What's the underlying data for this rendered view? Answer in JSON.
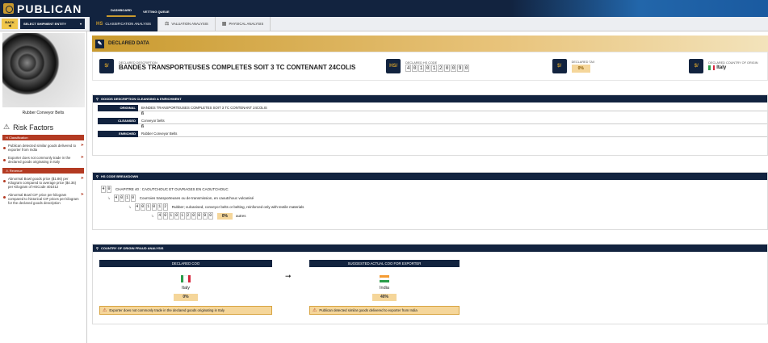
{
  "app": {
    "name": "PUBLICAN"
  },
  "topnav": [
    {
      "label": "DASHBOARD"
    },
    {
      "label": "VETTING QUEUE"
    }
  ],
  "secbar": {
    "back_label": "BACK",
    "shipment_select": "SELECT SHIPMENT ENTITY",
    "tabs": [
      {
        "label": "CLASSIFICATION ANALYSIS",
        "icon": "hs-icon",
        "active": true
      },
      {
        "label": "VALUATION ANALYSIS",
        "icon": "scale-icon",
        "active": false
      },
      {
        "label": "PHYSICAL ANALYSIS",
        "icon": "box-icon",
        "active": false
      }
    ]
  },
  "sidebar": {
    "product_name": "Rubber Conveyor Belts",
    "risk_title": "Risk Factors",
    "sections": [
      {
        "title": "Classification",
        "items": [
          "Publican detected similar goods delivered to exporter from India",
          "Exporter does not commonly trade in the declared goods originating in Italy"
        ]
      },
      {
        "title": "Revenue",
        "items": [
          "Abnormal Bowl goods price ($1.86) per Kilogram compared to average price ($4.35) per Kilogram of HSCode 401012",
          "Abnormal Bowl CIF price per kilogram compared to historical CIF prices per kilogram for the declared goods description"
        ]
      }
    ]
  },
  "declared": {
    "header": "DECLARED DATA",
    "description_label": "DECLARED DESCRIPTION",
    "description": "BANDES TRANSPORTEUSES COMPLETES SOIT 3 TC CONTENANT 24COLIS",
    "hs_label": "DECLARED HS CODE",
    "hs_code": [
      "4",
      "0",
      "1",
      "0",
      "1",
      "2",
      "0",
      "0",
      "9",
      "0"
    ],
    "tax_label": "DECLARED TAX",
    "tax": "0%",
    "country_label": "DECLARED COUNTRY OF ORIGIN",
    "country": "Italy"
  },
  "goods": {
    "header": "GOODS DESCRIPTION CLEANSING & ENRICHMENT",
    "rows": [
      {
        "label": "ORIGINAL",
        "value": "BANDES TRANSPORTEUSES COMPLETES SOIT 3 TC CONTENANT 24COLIS"
      },
      {
        "label": "CLEANSED",
        "value": "Conveyor belts"
      },
      {
        "label": "ENRICHED",
        "value": "Rubber Conveyor Belts"
      }
    ],
    "connector": "ß"
  },
  "hs": {
    "header": "HS CODE BREAKDOWN",
    "levels": [
      {
        "digits": [
          "4",
          "0"
        ],
        "text": "CHAPITRE 40 : CAOUTCHOUC ET OUVRAGES EN CAOUTCHOUC"
      },
      {
        "digits": [
          "4",
          "0",
          "1",
          "0"
        ],
        "text": "Courroies transporteuses ou de transmission, en caoutchouc vulcanisé"
      },
      {
        "digits": [
          "4",
          "0",
          "1",
          "0",
          "1",
          "2"
        ],
        "text": "Rubber; vulcanised, conveyor belts or belting, reinforced only with textile materials"
      },
      {
        "digits": [
          "4",
          "0",
          "1",
          "0",
          "1",
          "2",
          "0",
          "0",
          "9",
          "0"
        ],
        "pct": "0%",
        "text": "autres"
      }
    ]
  },
  "coo": {
    "header": "COUNTRY OF ORIGIN FRAUD ANALYSIS",
    "declared": {
      "head": "DECLARED COO",
      "country": "Italy",
      "pct": "0%",
      "alert": "Exporter does not commonly trade in the declared goods originating in Italy"
    },
    "suggested": {
      "head": "SUGGESTED ACTUAL COO FOR EXPORTER",
      "country": "India",
      "pct": "40%",
      "alert": "Publican detected similar goods delivered to exporter from India"
    },
    "arrow": "➞"
  }
}
